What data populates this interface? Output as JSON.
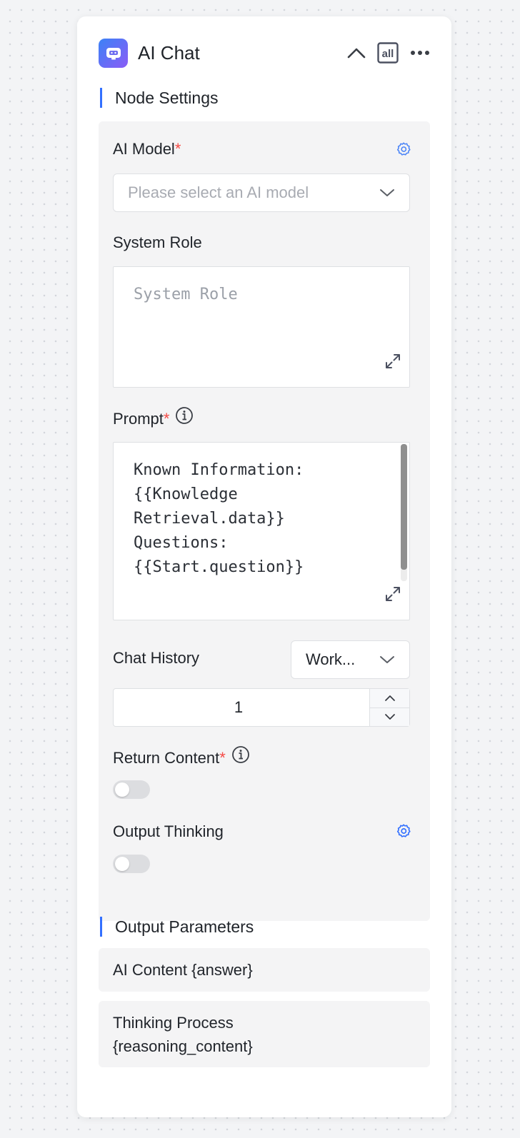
{
  "header": {
    "title": "AI Chat",
    "icons": {
      "app": "robot-icon",
      "collapse": "chevron-up-icon",
      "all": "all-icon",
      "more": "more-icon"
    },
    "all_label": "all"
  },
  "node_settings": {
    "title": "Node Settings",
    "ai_model": {
      "label": "AI Model",
      "required_mark": "*",
      "placeholder": "Please select an AI model"
    },
    "system_role": {
      "label": "System Role",
      "placeholder": "System Role"
    },
    "prompt": {
      "label": "Prompt",
      "required_mark": "*",
      "lines": [
        "Known Information:",
        "{{Knowledge",
        "Retrieval.data}}",
        "Questions:",
        "{{Start.question}}"
      ]
    },
    "chat_history": {
      "label": "Chat History",
      "select_value": "Work...",
      "count": "1"
    },
    "return_content": {
      "label": "Return Content",
      "required_mark": "*",
      "enabled": false
    },
    "output_thinking": {
      "label": "Output Thinking",
      "enabled": false
    }
  },
  "output_parameters": {
    "title": "Output Parameters",
    "items": [
      {
        "line1": "AI Content {answer}",
        "line2": ""
      },
      {
        "line1": "Thinking Process",
        "line2": "{reasoning_content}"
      }
    ]
  },
  "colors": {
    "accent": "#3370ff",
    "required": "#f54a45",
    "panel_bg": "#f4f4f5",
    "app_icon_gradient": [
      "#3b82f6",
      "#8b5cf6"
    ]
  }
}
